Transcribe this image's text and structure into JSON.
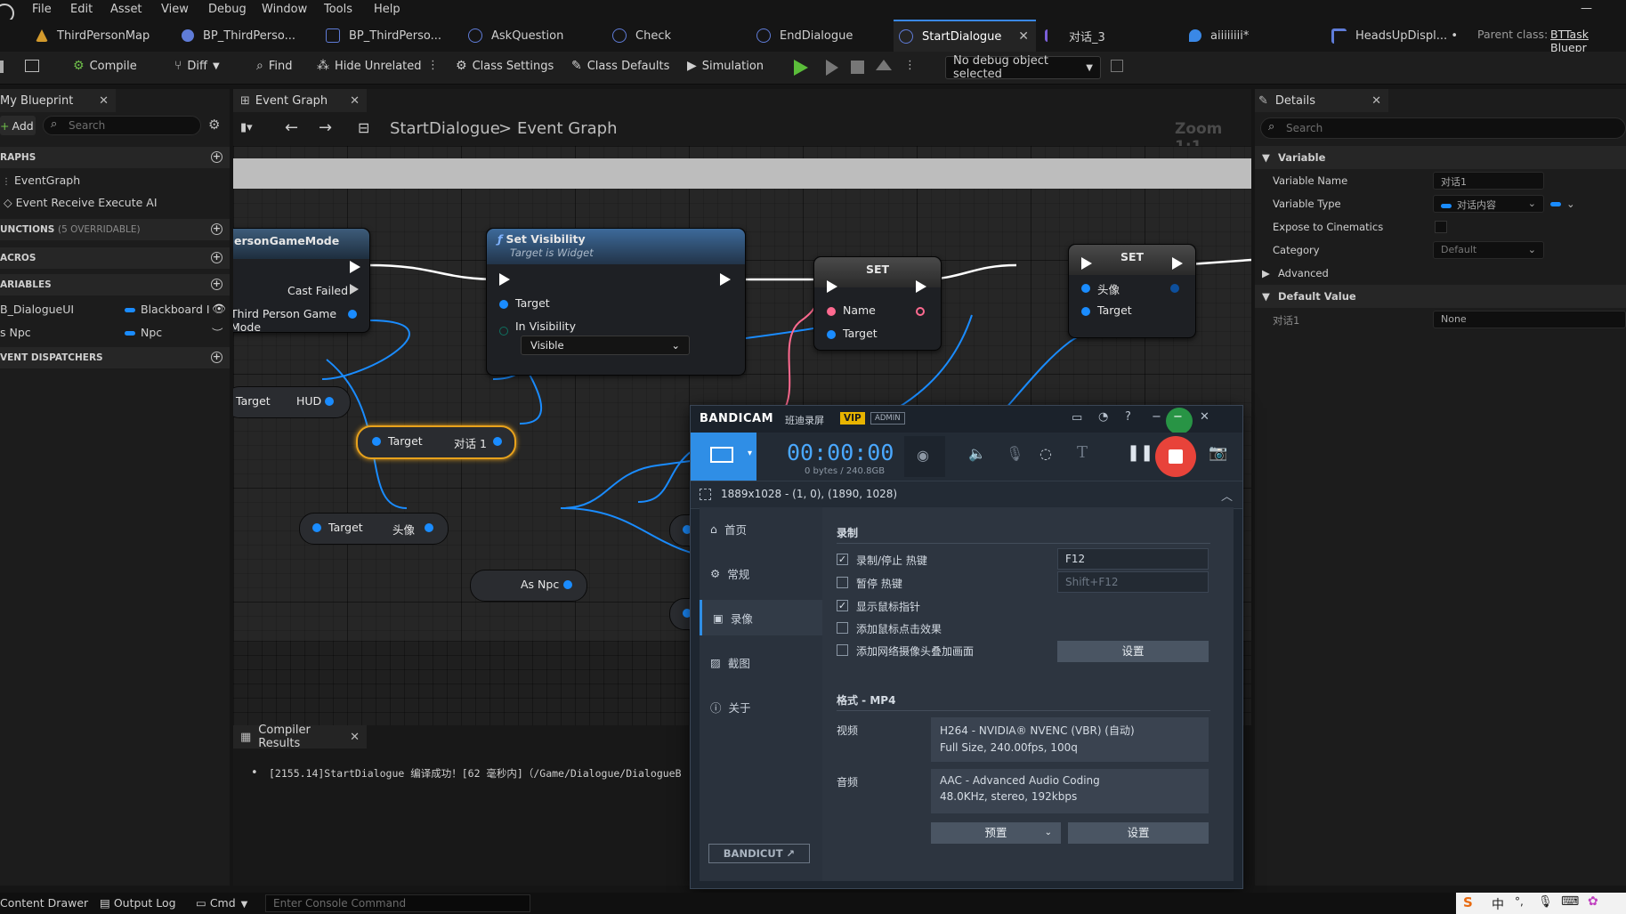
{
  "menu": [
    "File",
    "Edit",
    "Asset",
    "View",
    "Debug",
    "Window",
    "Tools",
    "Help"
  ],
  "tabs": [
    {
      "label": "ThirdPersonMap",
      "color": "#e0a030"
    },
    {
      "label": "BP_ThirdPerso...",
      "color": "#5f7cd8"
    },
    {
      "label": "BP_ThirdPerso...",
      "color": "#5f7cd8"
    },
    {
      "label": "AskQuestion",
      "color": "#5f7cd8"
    },
    {
      "label": "Check",
      "color": "#5f7cd8"
    },
    {
      "label": "EndDialogue",
      "color": "#5f7cd8"
    },
    {
      "label": "StartDialogue",
      "color": "#5f7cd8",
      "active": true
    },
    {
      "label": "对话_3",
      "color": "#7a5fd8"
    },
    {
      "label": "aiiiiiiii*",
      "color": "#3a88e6"
    },
    {
      "label": "HeadsUpDispl... •",
      "color": "#5f7cd8"
    }
  ],
  "parent_class": {
    "label": "Parent class:",
    "value": "BTTask Bluepr"
  },
  "toolbar": {
    "compile": "Compile",
    "diff": "Diff",
    "find": "Find",
    "hide_unrelated": "Hide Unrelated",
    "class_settings": "Class Settings",
    "class_defaults": "Class Defaults",
    "simulation": "Simulation",
    "debug_select": "No debug object selected"
  },
  "left_panel": {
    "tab": "My Blueprint",
    "add": "Add",
    "search_placeholder": "Search",
    "graphs_header": "RAPHS",
    "graph_items": [
      "EventGraph",
      "Event Receive Execute AI"
    ],
    "functions_header": "UNCTIONS",
    "functions_count": "(5 OVERRIDABLE)",
    "macros_header": "ACROS",
    "variables_header": "ARIABLES",
    "variables": [
      {
        "name": "B_DialogueUI",
        "type": "Blackboard I"
      },
      {
        "name": "s Npc",
        "type": "Npc"
      }
    ],
    "dispatchers_header": "VENT DISPATCHERS"
  },
  "graph": {
    "tab": "Event Graph",
    "breadcrumb_root": "StartDialogue",
    "breadcrumb_sep": ">",
    "breadcrumb_leaf": "Event Graph",
    "zoom": "Zoom 1:1",
    "nodes": {
      "cast": {
        "title": "ersonGameMode",
        "pin_fail": "Cast Failed",
        "pin_out": "Third Person Game Mode"
      },
      "set_visibility": {
        "title": "Set Visibility",
        "subtitle": "Target is Widget",
        "pin_target": "Target",
        "pin_vis": "In Visibility",
        "vis_value": "Visible"
      },
      "set1": {
        "title": "SET",
        "pin_name": "Name",
        "pin_target": "Target"
      },
      "set2": {
        "title": "SET",
        "pin_head": "头像",
        "pin_target": "Target"
      },
      "get_hud": {
        "left": "Target",
        "right": "HUD"
      },
      "get_dialog": {
        "left": "Target",
        "right": "对话 1"
      },
      "get_avatar": {
        "left": "Target",
        "right": "头像"
      },
      "as_npc": {
        "label": "As Npc"
      }
    }
  },
  "compiler": {
    "tab": "Compiler Results",
    "message": "[2155.14]StartDialogue 编译成功！[62 毫秒内]（/Game/Dialogue/DialogueB"
  },
  "details": {
    "tab": "Details",
    "search_placeholder": "Search",
    "variable_header": "Variable",
    "rows": [
      {
        "label": "Variable Name",
        "value": "对话1"
      },
      {
        "label": "Variable Type",
        "value": "对话内容"
      },
      {
        "label": "Expose to Cinematics",
        "value": ""
      },
      {
        "label": "Category",
        "value": "Default"
      }
    ],
    "advanced": "Advanced",
    "default_header": "Default Value",
    "default_row": {
      "label": "对话1",
      "value": "None"
    }
  },
  "bandicam": {
    "brand": "BANDICAM",
    "brand_cn": "班迪录屏",
    "vip": "VIP",
    "admin": "ADMIN",
    "timer": "00:00:00",
    "size": "0 bytes / 240.8GB",
    "resolution": "1889x1028 - (1, 0), (1890, 1028)",
    "nav": [
      "首页",
      "常规",
      "录像",
      "截图",
      "关于"
    ],
    "record_header": "录制",
    "options": [
      {
        "label": "录制/停止 热键",
        "checked": true,
        "hotkey": "F12"
      },
      {
        "label": "暂停 热键",
        "checked": false,
        "hotkey": "Shift+F12"
      },
      {
        "label": "显示鼠标指针",
        "checked": true
      },
      {
        "label": "添加鼠标点击效果",
        "checked": false
      },
      {
        "label": "添加网络摄像头叠加画面",
        "checked": false
      }
    ],
    "settings_btn": "设置",
    "format_header": "格式 - MP4",
    "video_label": "视频",
    "video_line1": "H264 - NVIDIA® NVENC (VBR) (自动)",
    "video_line2": "Full Size, 240.00fps, 100q",
    "audio_label": "音频",
    "audio_line1": "AAC - Advanced Audio Coding",
    "audio_line2": "48.0KHz, stereo, 192kbps",
    "preset_btn": "预置",
    "settings_btn2": "设置",
    "bandicut": "BANDICUT ↗"
  },
  "statusbar": {
    "content_drawer": "Content Drawer",
    "output_log": "Output Log",
    "cmd": "Cmd",
    "console_placeholder": "Enter Console Command",
    "ime": [
      "中",
      "°,",
      "⌨"
    ]
  }
}
